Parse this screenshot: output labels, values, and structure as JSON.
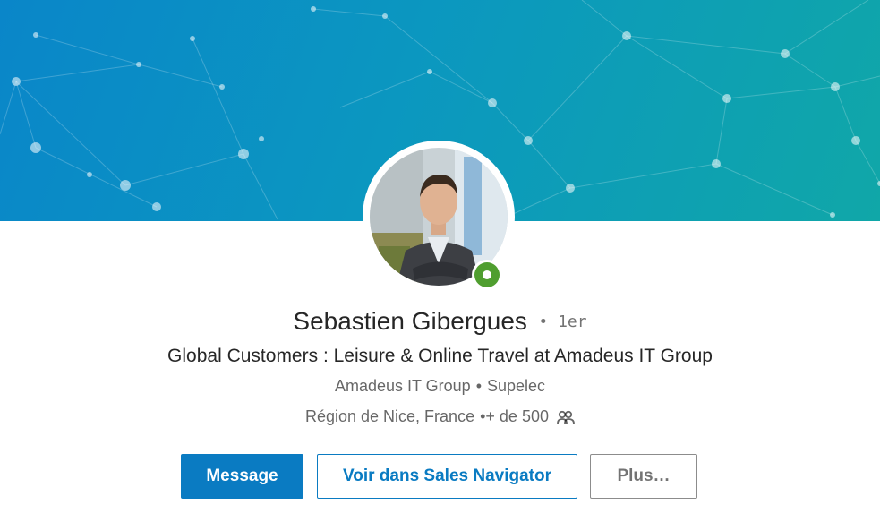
{
  "profile": {
    "name": "Sebastien Gibergues",
    "degree_bullet": "•",
    "degree": "1er",
    "headline": "Global Customers : Leisure & Online Travel at Amadeus IT Group",
    "company": "Amadeus IT Group",
    "school": "Supelec",
    "location": "Région de Nice, France",
    "connections": "+ de 500",
    "separator": "•",
    "status": "online"
  },
  "actions": {
    "message_label": "Message",
    "sales_navigator_label": "Voir dans Sales Navigator",
    "more_label": "Plus…"
  },
  "colors": {
    "accent": "#0a7bc2",
    "banner_start": "#0a86c9",
    "banner_end": "#10a7a8",
    "presence": "#4f9e2f"
  },
  "icons": {
    "connections": "people-icon",
    "presence": "online-status-icon"
  }
}
